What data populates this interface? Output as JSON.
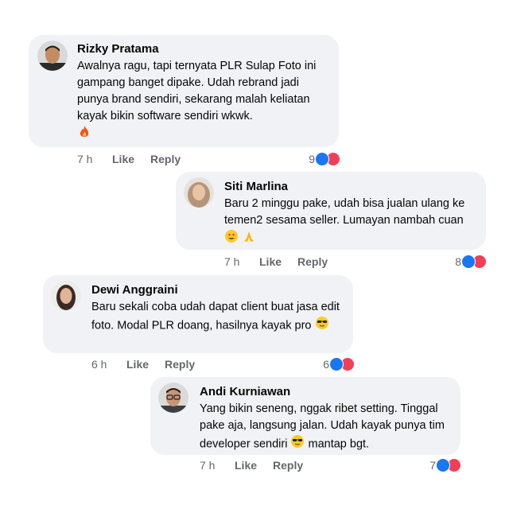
{
  "colors": {
    "bubble": "#f0f2f5",
    "meta_text": "#65676b",
    "like_blue": "#1877f2",
    "love_red": "#f33e58"
  },
  "comments": [
    {
      "name": "Rizky Pratama",
      "text": "Awalnya ragu, tapi ternyata PLR Sulap Foto ini gampang banget dipake. Udah rebrand jadi punya brand sendiri, sekarang malah keliatan kayak bikin software sendiri wkwk.",
      "emoji": "fire-emoji",
      "time": "7 h",
      "like": "Like",
      "reply": "Reply",
      "reactions": "9",
      "avatar": "avatar-man-short-hair"
    },
    {
      "name": "Siti Marlina",
      "text": "Baru 2 minggu pake, udah bisa jualan ulang ke temen2 sesama seller. Lumayan nambah cuan",
      "emoji": "heart-eyes-and-pray-emoji",
      "time": "7 h",
      "like": "Like",
      "reply": "Reply",
      "reactions": "8",
      "avatar": "avatar-woman-hijab"
    },
    {
      "name": "Dewi Anggraini",
      "text": "Baru sekali coba udah dapat client buat jasa edit foto. Modal PLR doang, hasilnya kayak pro",
      "emoji": "sunglasses-emoji",
      "time": "6 h",
      "like": "Like",
      "reply": "Reply",
      "reactions": "6",
      "avatar": "avatar-woman-dark-hair"
    },
    {
      "name": "Andi Kurniawan",
      "text": "Yang bikin seneng, nggak ribet setting. Tinggal pake aja, langsung jalan. Udah kayak punya tim developer sendiri",
      "text_after": "mantap bgt.",
      "emoji": "sunglasses-emoji",
      "time": "7 h",
      "like": "Like",
      "reply": "Reply",
      "reactions": "7",
      "avatar": "avatar-man-glasses"
    }
  ]
}
